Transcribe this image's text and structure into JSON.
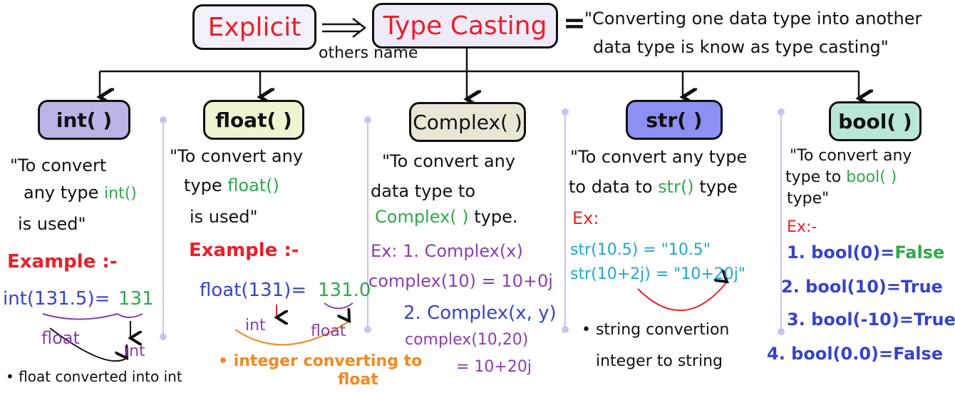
{
  "header": {
    "explicit": "Explicit",
    "type_casting": "Type Casting",
    "other_name": "others name",
    "equals": "=",
    "definition_line1": "\"Converting one data type into another",
    "definition_line2": "data type is know as type casting\""
  },
  "categories": {
    "int": {
      "label": "int( )",
      "desc": [
        "\"To convert",
        "any type",
        "int()",
        "is used\""
      ],
      "example_title": "Example :-",
      "example_lhs": "int(131.5)=",
      "example_rhs": "131",
      "from_label": "float",
      "to_label": "int",
      "note": "• float converted into int"
    },
    "float": {
      "label": "float( )",
      "desc": [
        "\"To convert any",
        "type",
        "float()",
        "is used\""
      ],
      "example_title": "Example :-",
      "example_lhs": "float(131)=",
      "example_rhs": "131.0",
      "from_label": "int",
      "to_label": "float",
      "note_line1": "• integer converting to",
      "note_line2": "float"
    },
    "complex": {
      "label": "Complex( )",
      "desc": [
        "\"To convert any",
        "data type to",
        "Complex( )",
        "type."
      ],
      "ex1_label": "Ex: 1. Complex(x)",
      "ex1_value": "complex(10) = 10+0j",
      "ex2_label": "2. Complex(x, y)",
      "ex2_call": "complex(10,20)",
      "ex2_value": "= 10+20j"
    },
    "str": {
      "label": "str( )",
      "desc": [
        "\"To convert any type",
        "to data to",
        "str()",
        "type"
      ],
      "ex_label": "Ex:",
      "ex1": "str(10.5) = \"10.5\"",
      "ex2": "str(10+2j) = \"10+20j\"",
      "note_line1": "• string convertion",
      "note_line2": "integer to string"
    },
    "bool": {
      "label": "bool( )",
      "desc": [
        "\"To convert any",
        "type to",
        "bool( )",
        "type\""
      ],
      "ex_label": "Ex:-",
      "ex1": "1. bool(0)=",
      "ex1_result": "False",
      "ex2": "2. bool(10)=True",
      "ex3": "3. bool(-10)=True",
      "ex4": "4. bool(0.0)=False"
    }
  },
  "colors": {
    "title_red": "#e8202a",
    "int_box": "#bcb3e6",
    "float_box": "#eef5d2",
    "complex_box": "#e9e6d6",
    "str_box": "#8d8ff2",
    "bool_box": "#b9e6d7"
  }
}
